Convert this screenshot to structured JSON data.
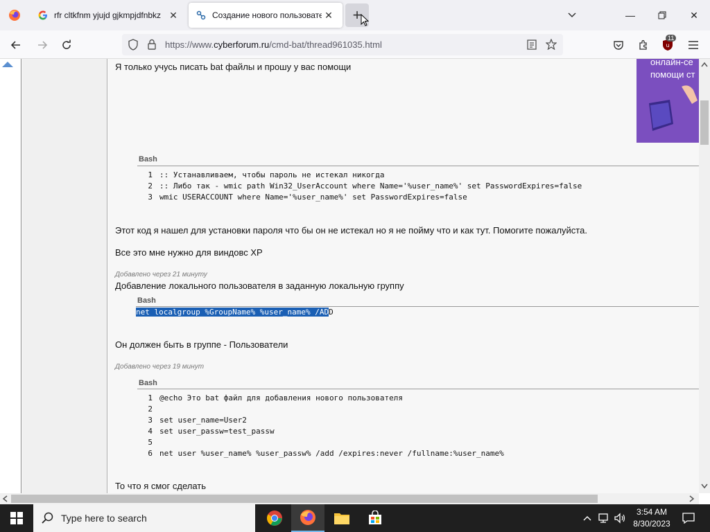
{
  "browser": {
    "tabs": [
      {
        "title": "rfr cltkfnm yjujd gjkmpjdfnbkz",
        "favicon": "google-icon"
      },
      {
        "title": "Создание нового пользовател",
        "favicon": "cyberforum-icon",
        "active": true
      }
    ],
    "url_prefix": "https://www.",
    "url_domain": "cyberforum.ru",
    "url_path": "/cmd-bat/thread961035.html",
    "extension_badge": "11"
  },
  "post": {
    "intro": "Я только учусь писать bat файлы и прошу у вас помощи",
    "ad_text": [
      "онлайн-се",
      "помощи ст"
    ],
    "code1": {
      "label": "Bash",
      "lines": [
        ":: Устанавливаем, чтобы пароль не истекал никогда",
        ":: Либо так - wmic path Win32_UserAccount where Name='%user_name%' set PasswordExpires=false",
        "wmic USERACCOUNT where Name='%user_name%' set PasswordExpires=false"
      ]
    },
    "para1": "Этот код я нашел для установки пароля что бы он не истекал но я не пойму что и как тут. Помогите пожалуйста.",
    "para2": "Все это мне нужно для виндовс XP",
    "added1": "Добавлено через 21 минуту",
    "heading2": "Добавление локального пользователя в заданную локальную группу",
    "code2": {
      "label": "Bash",
      "selected": "net localgroup %GroupName% %user_name% /AD",
      "rest": "D"
    },
    "para3": "Он должен быть в группе - Пользователи",
    "added2": "Добавлено через 19 минут",
    "code3": {
      "label": "Bash",
      "lines": [
        "@echo Это bat файл для добавления нового пользователя",
        "",
        "set user_name=User2",
        "set user_passw=test_passw",
        "",
        "net user %user_name% %user_passw% /add /expires:never /fullname:%user_name%"
      ]
    },
    "para4": "То что я смог сделать"
  },
  "taskbar": {
    "search_placeholder": "Type here to search",
    "time": "3:54 AM",
    "date": "8/30/2023"
  }
}
